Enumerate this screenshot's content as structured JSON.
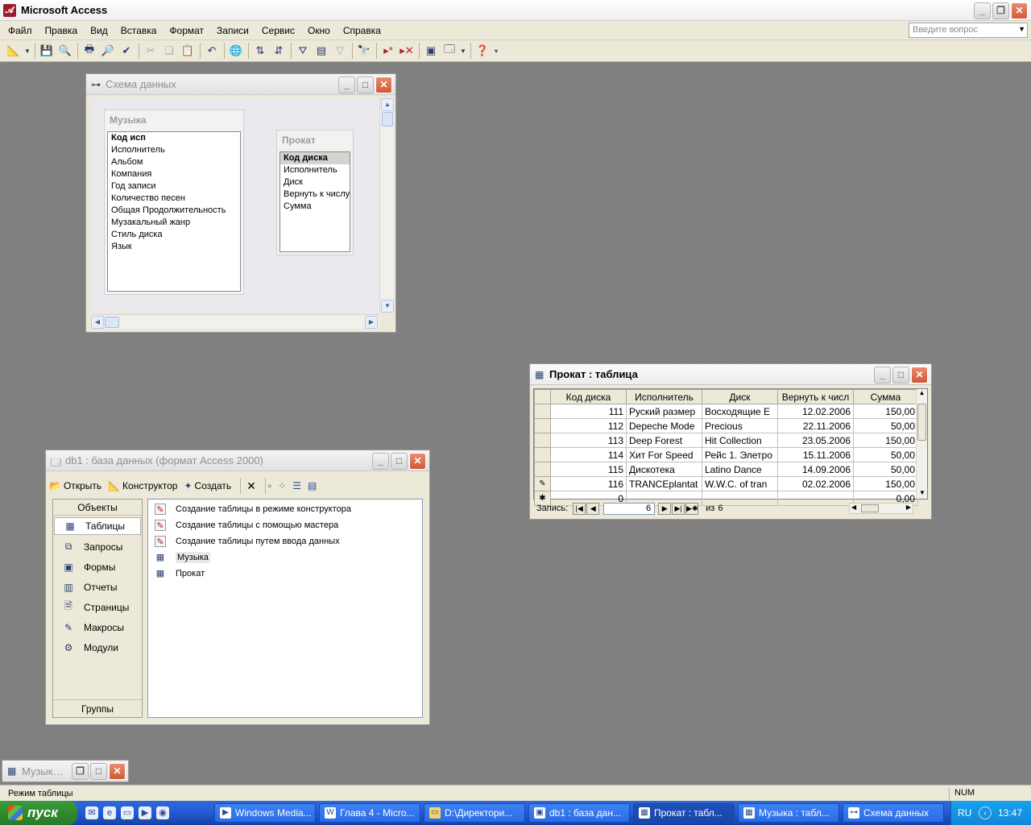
{
  "app": {
    "title": "Microsoft Access"
  },
  "menu": [
    "Файл",
    "Правка",
    "Вид",
    "Вставка",
    "Формат",
    "Записи",
    "Сервис",
    "Окно",
    "Справка"
  ],
  "help_placeholder": "Введите вопрос",
  "relations_window": {
    "title": "Схема данных",
    "tables": [
      {
        "name": "Музыка",
        "fields": [
          "Код исп",
          "Исполнитель",
          "Альбом",
          "Компания",
          "Год записи",
          "Количество песен",
          "Общая Продолжительность",
          "Музакальный жанр",
          "Стиль диска",
          "Язык"
        ]
      },
      {
        "name": "Прокат",
        "fields": [
          "Код диска",
          "Исполнитель",
          "Диск",
          "Вернуть к числу",
          "Сумма"
        ]
      }
    ]
  },
  "datasheet_window": {
    "title": "Прокат : таблица",
    "columns": [
      "Код диска",
      "Исполнитель",
      "Диск",
      "Вернуть к числ",
      "Сумма"
    ],
    "rows": [
      [
        "111",
        "Руский размер",
        "Восходящие Е",
        "12.02.2006",
        "150,00"
      ],
      [
        "112",
        "Depeche Mode",
        "Precious",
        "22.11.2006",
        "50,00"
      ],
      [
        "113",
        "Deep Forest",
        "Hit Collection",
        "23.05.2006",
        "150,00"
      ],
      [
        "114",
        "Хит For Speed",
        "Рейс 1. Элетро",
        "15.11.2006",
        "50,00"
      ],
      [
        "115",
        "Дискотека",
        "Latino Dance",
        "14.09.2006",
        "50,00"
      ],
      [
        "116",
        "TRANCEplantat",
        "W.W.C. of tran",
        "02.02.2006",
        "150,00"
      ]
    ],
    "new_row": [
      "0",
      "",
      "",
      "",
      "0,00"
    ],
    "nav": {
      "label": "Запись:",
      "current": "6",
      "of_label": "из",
      "total": "6"
    }
  },
  "db_window": {
    "title": "db1 : база данных (формат Access 2000)",
    "toolbar": {
      "open": "Открыть",
      "design": "Конструктор",
      "create": "Создать"
    },
    "objects_header": "Объекты",
    "objects": [
      "Таблицы",
      "Запросы",
      "Формы",
      "Отчеты",
      "Страницы",
      "Макросы",
      "Модули"
    ],
    "groups": "Группы",
    "list": [
      "Создание таблицы в режиме конструктора",
      "Создание таблицы с помощью мастера",
      "Создание таблицы путем ввода данных",
      "Музыка",
      "Прокат"
    ]
  },
  "minimized_window": {
    "title": "Музык…"
  },
  "status": {
    "text": "Режим таблицы",
    "num": "NUM"
  },
  "taskbar": {
    "start": "пуск",
    "tasks": [
      "Windows Media...",
      "Глава 4 - Micro...",
      "D:\\Директори...",
      "db1 : база дан...",
      "Прокат : табл...",
      "Музыка : табл...",
      "Схема данных"
    ],
    "lang": "RU",
    "time": "13:47"
  }
}
